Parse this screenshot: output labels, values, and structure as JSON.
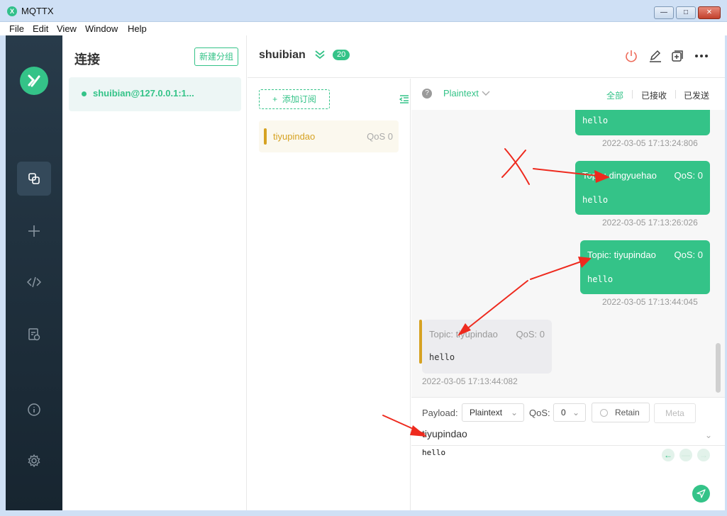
{
  "window": {
    "title": "MQTTX",
    "app_icon_glyph": "X"
  },
  "menu": {
    "file": "File",
    "edit": "Edit",
    "view": "View",
    "window": "Window",
    "help": "Help"
  },
  "connections": {
    "title": "连接",
    "new_group": "新建分组",
    "items": [
      {
        "name": "shuibian@127.0.0.1:1...",
        "status_color": "#34c388"
      }
    ]
  },
  "header": {
    "connection_name": "shuibian",
    "message_count": "20"
  },
  "subscriptions": {
    "add_label": "添加订阅",
    "items": [
      {
        "topic": "tiyupindao",
        "qos": "QoS 0",
        "color": "#d6a222"
      }
    ]
  },
  "toolbar": {
    "help_glyph": "?",
    "payload_type": "Plaintext",
    "filters": {
      "all": "全部",
      "received": "已接收",
      "sent": "已发送"
    }
  },
  "messages": [
    {
      "direction": "out",
      "topic": "",
      "qos": "",
      "payload": "hello",
      "time": "2022-03-05 17:13:24:806"
    },
    {
      "direction": "out",
      "topic": "Topic: dingyuehao",
      "qos": "QoS: 0",
      "payload": "hello",
      "time": "2022-03-05 17:13:26:026"
    },
    {
      "direction": "out",
      "topic": "Topic: tiyupindao",
      "qos": "QoS: 0",
      "payload": "hello",
      "time": "2022-03-05 17:13:44:045"
    },
    {
      "direction": "in",
      "topic": "Topic: tiyupindao",
      "qos": "QoS: 0",
      "payload": "hello",
      "time": "2022-03-05 17:13:44:082"
    }
  ],
  "publish": {
    "payload_label": "Payload:",
    "payload_format": "Plaintext",
    "qos_label": "QoS:",
    "qos_value": "0",
    "retain_label": "Retain",
    "meta_label": "Meta",
    "topic": "tiyupindao",
    "payload": "hello"
  },
  "colors": {
    "accent": "#34c388",
    "sidebar": "#1f303d",
    "subscription": "#d6a222",
    "annotation": "#ee2a1e"
  }
}
